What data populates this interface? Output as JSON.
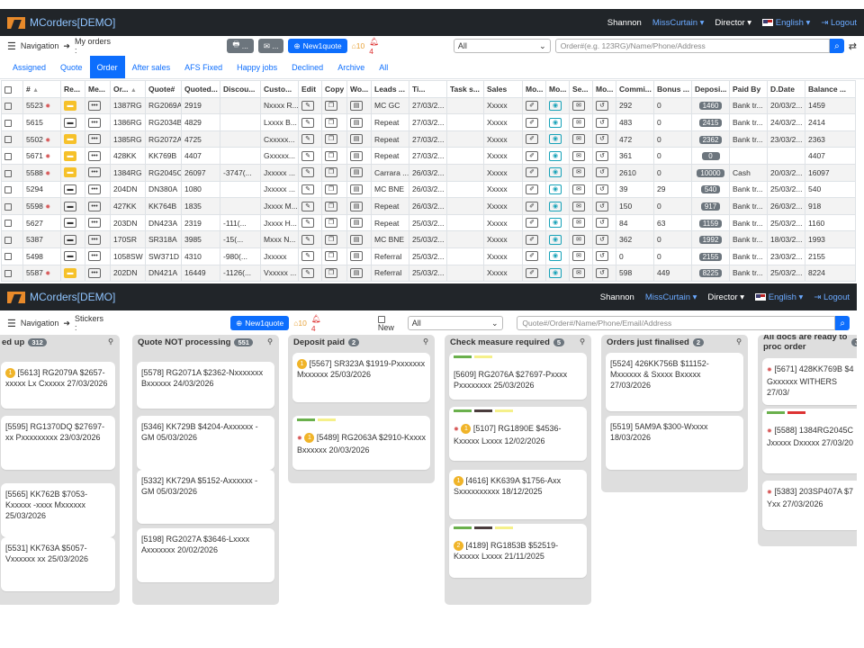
{
  "app": {
    "title": "MCorders[DEMO]",
    "user": "Shannon",
    "account": "MissCurtain",
    "role": "Director",
    "language": "English",
    "logout": "Logout"
  },
  "orders": {
    "nav_label": "Navigation",
    "crumb": "My orders :",
    "new_quote": "New1quote",
    "warn_count": "10",
    "alert_count": "4",
    "filter_select": "All",
    "search_placeholder": "Order#(e.g. 123RG)/Name/Phone/Address",
    "tabs": [
      "Assigned",
      "Quote",
      "Order",
      "After sales",
      "AFS Fixed",
      "Happy jobs",
      "Declined",
      "Archive",
      "All"
    ],
    "active_tab": "Order",
    "columns": [
      "#",
      "Re...",
      "Me...",
      "Or...",
      "Quote#",
      "Quoted...",
      "Discou...",
      "Custo...",
      "Edit",
      "Copy",
      "Wo...",
      "Leads ...",
      "Ti...",
      "Task s...",
      "Sales",
      "Mo...",
      "Mo...",
      "Se...",
      "Mo...",
      "Commi...",
      "Bonus ...",
      "Deposi...",
      "Paid By",
      "D.Date",
      "Balance ..."
    ],
    "rows": [
      {
        "id": "5523",
        "bug": true,
        "yellow": true,
        "ord": "1387RG",
        "quote": "RG2069A",
        "quoted": "2919",
        "disc": "",
        "cust": "Nxxxx R...",
        "lead": "MC GC",
        "time": "27/03/2...",
        "sales": "Xxxxx",
        "comm": "292",
        "bonus": "0",
        "deposit": "1460",
        "paid": "Bank tr...",
        "ddate": "20/03/2...",
        "bal": "1459"
      },
      {
        "id": "5615",
        "bug": false,
        "yellow": false,
        "ord": "1386RG",
        "quote": "RG2034B",
        "quoted": "4829",
        "disc": "",
        "cust": "Lxxxx B...",
        "lead": "Repeat",
        "time": "27/03/2...",
        "sales": "Xxxxx",
        "comm": "483",
        "bonus": "0",
        "deposit": "2415",
        "paid": "Bank tr...",
        "ddate": "24/03/2...",
        "bal": "2414"
      },
      {
        "id": "5502",
        "bug": true,
        "yellow": true,
        "ord": "1385RG",
        "quote": "RG2072A",
        "quoted": "4725",
        "disc": "",
        "cust": "Cxxxxx...",
        "lead": "Repeat",
        "time": "27/03/2...",
        "sales": "Xxxxx",
        "comm": "472",
        "bonus": "0",
        "deposit": "2362",
        "paid": "Bank tr...",
        "ddate": "23/03/2...",
        "bal": "2363"
      },
      {
        "id": "5671",
        "bug": true,
        "yellow": true,
        "ord": "428KK",
        "quote": "KK769B",
        "quoted": "4407",
        "disc": "",
        "cust": "Gxxxxx...",
        "lead": "Repeat",
        "time": "27/03/2...",
        "sales": "Xxxxx",
        "comm": "361",
        "bonus": "0",
        "deposit": "0",
        "paid": "",
        "ddate": "",
        "bal": "4407"
      },
      {
        "id": "5588",
        "bug": true,
        "yellow": true,
        "ord": "1384RG",
        "quote": "RG2045C",
        "quoted": "26097",
        "disc": "-3747(...",
        "cust": "Jxxxxx ...",
        "lead": "Carrara ...",
        "time": "26/03/2...",
        "sales": "Xxxxx",
        "comm": "2610",
        "bonus": "0",
        "deposit": "10000",
        "paid": "Cash",
        "ddate": "20/03/2...",
        "bal": "16097"
      },
      {
        "id": "5294",
        "bug": false,
        "yellow": false,
        "ord": "204DN",
        "quote": "DN380A",
        "quoted": "1080",
        "disc": "",
        "cust": "Jxxxxx ...",
        "lead": "MC BNE",
        "time": "26/03/2...",
        "sales": "Xxxxx",
        "comm": "39",
        "bonus": "29",
        "deposit": "540",
        "paid": "Bank tr...",
        "ddate": "25/03/2...",
        "bal": "540"
      },
      {
        "id": "5598",
        "bug": true,
        "yellow": false,
        "ord": "427KK",
        "quote": "KK764B",
        "quoted": "1835",
        "disc": "",
        "cust": "Jxxxx M...",
        "lead": "Repeat",
        "time": "26/03/2...",
        "sales": "Xxxxx",
        "comm": "150",
        "bonus": "0",
        "deposit": "917",
        "paid": "Bank tr...",
        "ddate": "26/03/2...",
        "bal": "918"
      },
      {
        "id": "5627",
        "bug": false,
        "yellow": false,
        "ord": "203DN",
        "quote": "DN423A",
        "quoted": "2319",
        "disc": "-111(...",
        "cust": "Jxxxx H...",
        "lead": "Repeat",
        "time": "25/03/2...",
        "sales": "Xxxxx",
        "comm": "84",
        "bonus": "63",
        "deposit": "1159",
        "paid": "Bank tr...",
        "ddate": "25/03/2...",
        "bal": "1160"
      },
      {
        "id": "5387",
        "bug": false,
        "yellow": false,
        "ord": "170SR",
        "quote": "SR318A",
        "quoted": "3985",
        "disc": "-15(...",
        "cust": "Mxxx N...",
        "lead": "MC BNE",
        "time": "25/03/2...",
        "sales": "Xxxxx",
        "comm": "362",
        "bonus": "0",
        "deposit": "1992",
        "paid": "Bank tr...",
        "ddate": "18/03/2...",
        "bal": "1993"
      },
      {
        "id": "5498",
        "bug": false,
        "yellow": false,
        "ord": "1058SW",
        "quote": "SW371D",
        "quoted": "4310",
        "disc": "-980(...",
        "cust": "Jxxxxx",
        "lead": "Referral",
        "time": "25/03/2...",
        "sales": "Xxxxx",
        "comm": "0",
        "bonus": "0",
        "deposit": "2155",
        "paid": "Bank tr...",
        "ddate": "23/03/2...",
        "bal": "2155"
      },
      {
        "id": "5587",
        "bug": true,
        "yellow": true,
        "ord": "202DN",
        "quote": "DN421A",
        "quoted": "16449",
        "disc": "-1126(...",
        "cust": "Vxxxxx ...",
        "lead": "Referral",
        "time": "25/03/2...",
        "sales": "Xxxxx",
        "comm": "598",
        "bonus": "449",
        "deposit": "8225",
        "paid": "Bank tr...",
        "ddate": "25/03/2...",
        "bal": "8224"
      }
    ]
  },
  "stickers": {
    "nav_label": "Navigation",
    "crumb": "Stickers :",
    "new_quote": "New1quote",
    "warn_count": "10",
    "alert_count": "4",
    "new_label": "New",
    "filter_select": "All",
    "search_placeholder": "Quote#/Order#/Name/Phone/Email/Address",
    "columns": [
      {
        "title": "ed up",
        "count": "312",
        "cards": [
          {
            "text": "[5613] RG2079A $2657-xxxxx Lx Cxxxxx 27/03/2026",
            "badge": "1",
            "bars": []
          },
          {
            "text": "[5595] RG1370DQ $27697-xx Pxxxxxxxxx 23/03/2026",
            "badge": "",
            "bars": []
          },
          {
            "text": "[5565] KK762B $7053-Kxxxxx -xxxx Mxxxxxx 25/03/2026",
            "badge": "",
            "bars": []
          },
          {
            "text": "[5531] KK763A $5057-Vxxxxxx xx 25/03/2026",
            "badge": "",
            "bars": []
          }
        ]
      },
      {
        "title": "Quote NOT processing",
        "count": "551",
        "cards": [
          {
            "text": "[5578] RG2071A $2362-Nxxxxxxx Bxxxxxx 24/03/2026",
            "badge": "",
            "bars": []
          },
          {
            "text": "[5346] KK729B $4204-Axxxxxx -GM 05/03/2026",
            "badge": "",
            "bars": []
          },
          {
            "text": "[5332] KK729A $5152-Axxxxxx -GM 05/03/2026",
            "badge": "",
            "bars": []
          },
          {
            "text": "[5198] RG2027A $3646-Lxxxx Axxxxxxx 20/02/2026",
            "badge": "",
            "bars": []
          }
        ]
      },
      {
        "title": "Deposit paid",
        "count": "2",
        "cards": [
          {
            "text": "[5567] SR323A $1919-Pxxxxxxx Mxxxxxx 25/03/2026",
            "badge": "1",
            "bars": []
          },
          {
            "text": "[5489] RG2063A $2910-Kxxxx Bxxxxxx 20/03/2026",
            "badge": "1",
            "bars": [
              "#6ab04c",
              "#f5f08a"
            ]
          }
        ]
      },
      {
        "title": "Check measure required",
        "count": "5",
        "cards": [
          {
            "text": "[5609] RG2076A $27697-Pxxxx Pxxxxxxxx 25/03/2026",
            "badge": "",
            "bars": [
              "#6ab04c",
              "#f5f08a"
            ]
          },
          {
            "text": "[5107] RG1890E $4536-Kxxxxx Lxxxx 12/02/2026",
            "badge": "1",
            "bars": [
              "#6ab04c",
              "#4a3c3c",
              "#f5f08a"
            ]
          },
          {
            "text": "[4616] KK639A $1756-Axx Sxxxxxxxxxx 18/12/2025",
            "badge": "1",
            "bars": []
          },
          {
            "text": "[4189] RG1853B $52519-Kxxxxx Lxxxx 21/11/2025",
            "badge": "2",
            "bars": [
              "#6ab04c",
              "#4a3c3c",
              "#f5f08a"
            ]
          }
        ]
      },
      {
        "title": "Orders just finalised",
        "count": "2",
        "cards": [
          {
            "text": "[5524] 426KK756B $11152-Mxxxxxx & Sxxxx Bxxxxx 27/03/2026",
            "badge": "",
            "bars": []
          },
          {
            "text": "[5519] 5AM9A $300-Wxxxx 18/03/2026",
            "badge": "",
            "bars": []
          }
        ]
      },
      {
        "title": "All docs are ready to proc order",
        "count": "3",
        "cards": [
          {
            "text": "[5671] 428KK769B $4 Gxxxxxx WITHERS 27/03/",
            "badge": "",
            "bars": []
          },
          {
            "text": "[5588] 1384RG2045C Jxxxxx Dxxxxx 27/03/20",
            "badge": "",
            "bars": [
              "#6ab04c",
              "#d33"
            ]
          },
          {
            "text": "[5383] 203SP407A $7 Yxx 27/03/2026",
            "badge": "",
            "bars": []
          }
        ]
      }
    ]
  }
}
